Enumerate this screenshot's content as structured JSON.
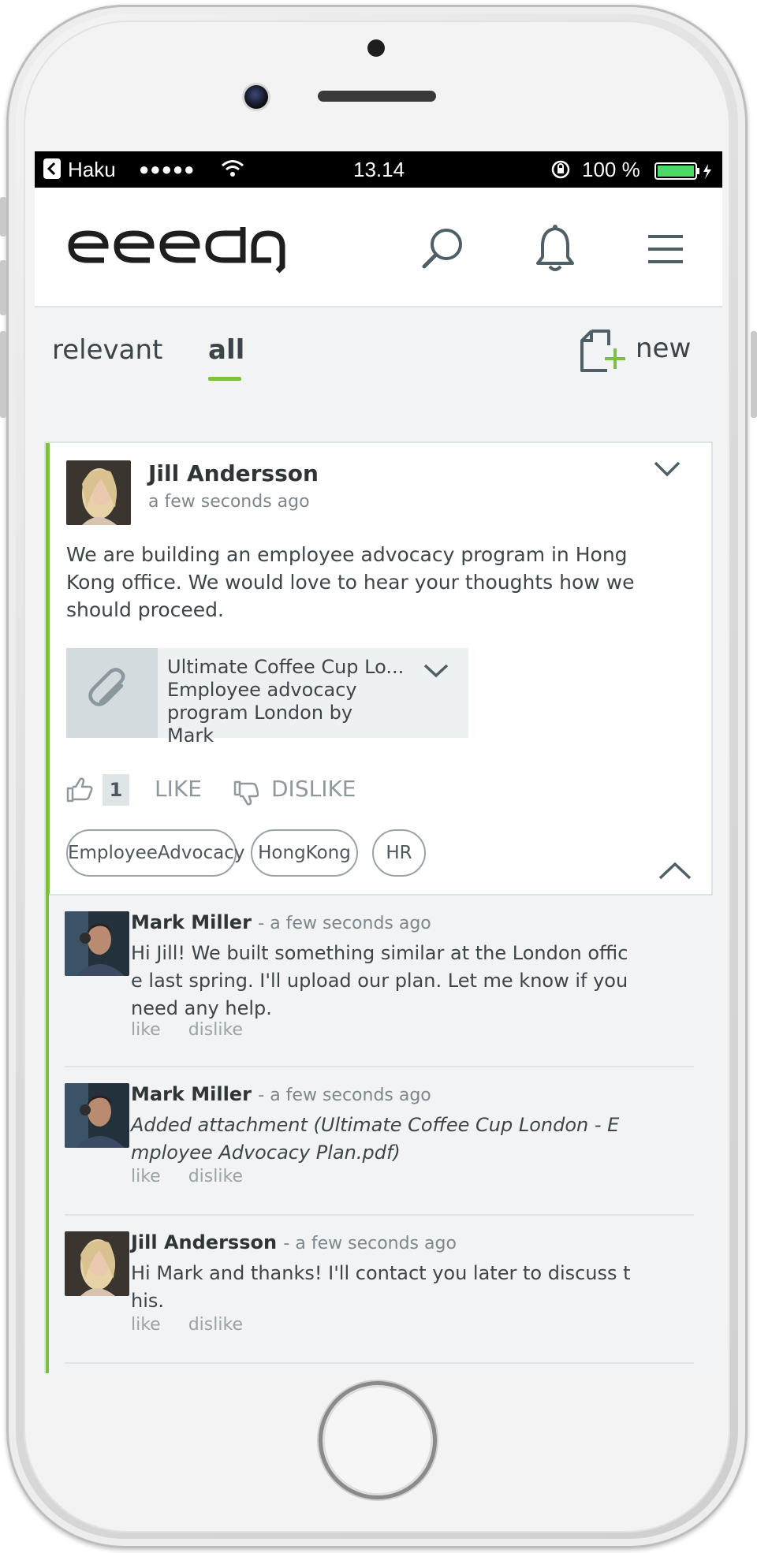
{
  "statusbar": {
    "back_app": "Haku",
    "signal": "●●●●●",
    "time": "13.14",
    "battery": "100 %"
  },
  "app": {
    "logo": "eeedq"
  },
  "filters": {
    "tabs": [
      {
        "label": "relevant",
        "active": false
      },
      {
        "label": "all",
        "active": true
      }
    ],
    "new_label": "new"
  },
  "post": {
    "author": "Jill Andersson",
    "time": "a few seconds ago",
    "body": "We are building an employee advocacy program in Hong Kong office. We would love to hear your thoughts how we should proceed.",
    "attachment": {
      "title": "Ultimate Coffee Cup Lo...",
      "subtitle": "Employee advocacy program London by Mark"
    },
    "like_count": "1",
    "like_label": "LIKE",
    "dislike_label": "DISLIKE",
    "tags": [
      "EmployeeAdvocacy",
      "HongKong",
      "HR"
    ]
  },
  "comments": [
    {
      "author": "Mark Miller",
      "time": "a few seconds ago",
      "text": "Hi Jill! We built something similar at the London office last spring. I'll upload our plan. Let me know if you need any help.",
      "like": "like",
      "dislike": "dislike"
    },
    {
      "author": "Mark Miller",
      "time": "a few seconds ago",
      "text": "Added attachment (Ultimate Coffee Cup London - Employee Advocacy Plan.pdf)",
      "like": "like",
      "dislike": "dislike"
    },
    {
      "author": "Jill Andersson",
      "time": "a few seconds ago",
      "text": "Hi Mark and thanks! I'll contact you later to discuss this.",
      "like": "like",
      "dislike": "dislike"
    }
  ],
  "colors": {
    "accent_green": "#7bc043",
    "icon_gray": "#4f5f66",
    "statusbar_bg": "#000000"
  },
  "icons": {
    "search": "search-icon",
    "bell": "bell-icon",
    "menu": "menu-icon",
    "new_post": "new-post-icon",
    "paperclip": "paperclip-icon",
    "chevron_down": "chevron-down-icon",
    "chevron_up": "chevron-up-icon",
    "thumbs_up": "thumbs-up-icon",
    "thumbs_down": "thumbs-down-icon"
  }
}
